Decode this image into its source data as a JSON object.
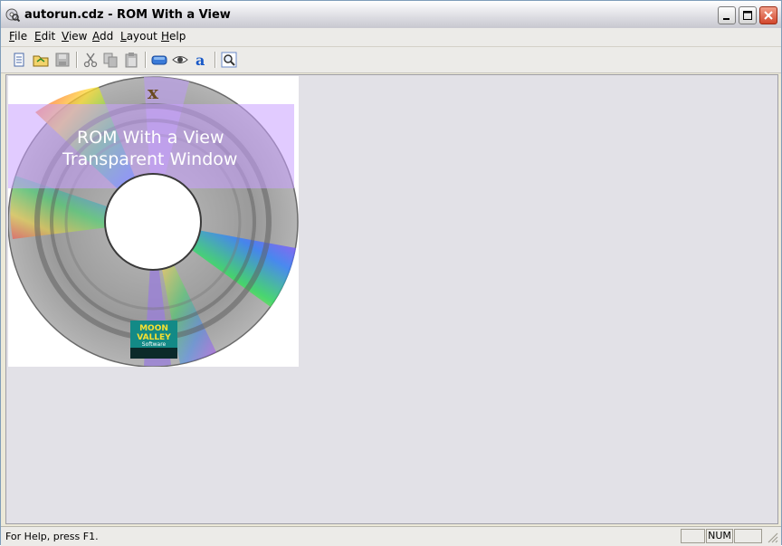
{
  "window": {
    "title": "autorun.cdz - ROM With a View"
  },
  "menu": {
    "items": [
      {
        "accel": "F",
        "rest": "ile"
      },
      {
        "accel": "E",
        "rest": "dit"
      },
      {
        "accel": "V",
        "rest": "iew"
      },
      {
        "accel": "A",
        "rest": "dd"
      },
      {
        "accel": "L",
        "rest": "ayout"
      },
      {
        "accel": "H",
        "rest": "elp"
      }
    ]
  },
  "toolbar": {
    "buttons": [
      "new-icon",
      "open-icon",
      "save-icon",
      "cut-icon",
      "copy-icon",
      "paste-icon",
      "button-shape-icon",
      "eye-icon",
      "text-icon",
      "zoom-icon"
    ]
  },
  "cd": {
    "banner_line1": "ROM With a View",
    "banner_line2": "Transparent Window",
    "close_glyph": "x",
    "logo_line1": "MOON",
    "logo_line2": "VALLEY",
    "logo_line3": "Software",
    "banner_color": "#c8a0ff"
  },
  "status": {
    "help_text": "For Help, press F1.",
    "num": "NUM"
  }
}
